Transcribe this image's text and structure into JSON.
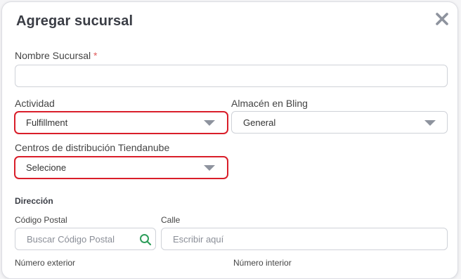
{
  "modal": {
    "title": "Agregar sucursal",
    "close_icon": "close-icon"
  },
  "form": {
    "nombre_label": "Nombre Sucursal",
    "required_mark": "*",
    "nombre_value": "",
    "actividad_label": "Actividad",
    "actividad_value": "Fulfillment",
    "almacen_label": "Almacén en Bling",
    "almacen_value": "General",
    "centros_label": "Centros de distribución Tiendanube",
    "centros_value": "Selecione",
    "direccion_heading": "Dirección",
    "cp_label": "Código Postal",
    "cp_placeholder": "Buscar Código Postal",
    "calle_label": "Calle",
    "calle_placeholder": "Escribir aquí",
    "num_ext_label": "Número exterior",
    "num_int_label": "Número interior"
  },
  "colors": {
    "highlight": "#d91e2a",
    "search_icon": "#2e9e5b",
    "required": "#e05a5a"
  }
}
